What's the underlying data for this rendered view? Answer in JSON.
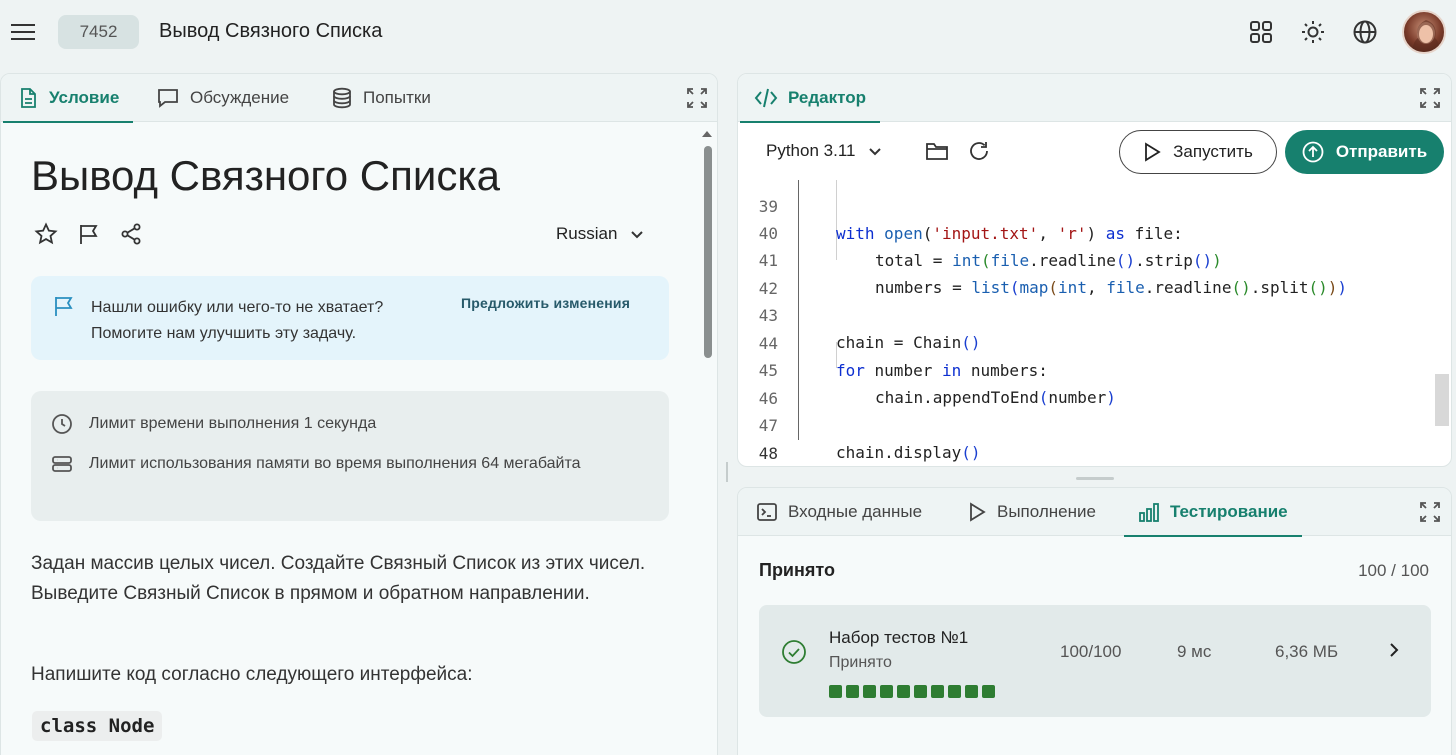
{
  "header": {
    "problem_number": "7452",
    "problem_title": "Вывод Связного Списка"
  },
  "left_tabs": [
    {
      "label": "Условие",
      "icon": "document-icon"
    },
    {
      "label": "Обсуждение",
      "icon": "chat-icon"
    },
    {
      "label": "Попытки",
      "icon": "database-icon"
    }
  ],
  "problem": {
    "title": "Вывод Связного Списка",
    "language_select": "Russian",
    "notice_line1": "Нашли ошибку или чего-то не хватает?",
    "notice_line2": "Помогите нам улучшить эту задачу.",
    "notice_link": "Предложить изменения",
    "time_limit": "Лимит времени выполнения 1 секунда",
    "memory_limit": "Лимит использования памяти во время выполнения 64 мегабайта",
    "description": "Задан массив целых чисел. Создайте Связный Список из этих чисел. Выведите Связный Список в прямом и обратном направлении.",
    "interface_intro": "Напишите код согласно следующего интерфейса:",
    "code_chip": "class Node"
  },
  "editor": {
    "tab_label": "Редактор",
    "language": "Python 3.11",
    "run_label": "Запустить",
    "submit_label": "Отправить",
    "line_numbers": [
      "39",
      "40",
      "41",
      "42",
      "43",
      "44",
      "45",
      "46",
      "47",
      "48"
    ]
  },
  "result_tabs": [
    {
      "label": "Входные данные",
      "icon": "terminal-icon"
    },
    {
      "label": "Выполнение",
      "icon": "play-icon"
    },
    {
      "label": "Тестирование",
      "icon": "bar-chart-icon"
    }
  ],
  "results": {
    "status": "Принято",
    "score": "100 / 100",
    "test_set": {
      "name": "Набор тестов №1",
      "status": "Принято",
      "score": "100/100",
      "time": "9 мс",
      "memory": "6,36 МБ",
      "passed_tests": 10
    }
  },
  "colors": {
    "accent": "#17806e",
    "test_pass": "#2e7d32",
    "notice_bg": "#e4f4fb"
  }
}
